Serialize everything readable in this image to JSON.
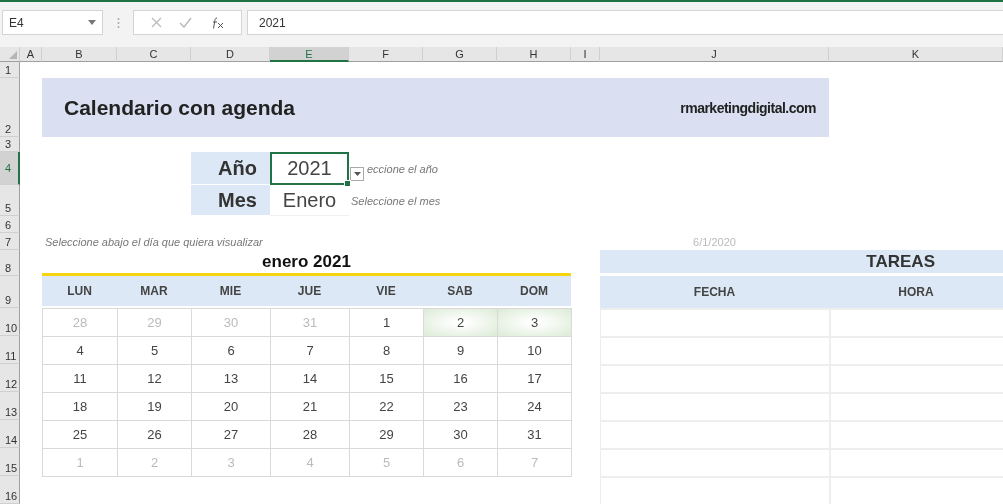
{
  "name_box": {
    "value": "E4"
  },
  "formula_bar": {
    "value": "2021"
  },
  "column_headers": [
    {
      "label": "A",
      "selected": false
    },
    {
      "label": "B",
      "selected": false
    },
    {
      "label": "C",
      "selected": false
    },
    {
      "label": "D",
      "selected": false
    },
    {
      "label": "E",
      "selected": true
    },
    {
      "label": "F",
      "selected": false
    },
    {
      "label": "G",
      "selected": false
    },
    {
      "label": "H",
      "selected": false
    },
    {
      "label": "I",
      "selected": false
    },
    {
      "label": "J",
      "selected": false
    },
    {
      "label": "K",
      "selected": false
    }
  ],
  "row_headers": [
    {
      "label": "1",
      "selected": false
    },
    {
      "label": "2",
      "selected": false
    },
    {
      "label": "3",
      "selected": false
    },
    {
      "label": "4",
      "selected": true
    },
    {
      "label": "5",
      "selected": false
    },
    {
      "label": "6",
      "selected": false
    },
    {
      "label": "7",
      "selected": false
    },
    {
      "label": "8",
      "selected": false
    },
    {
      "label": "9",
      "selected": false
    },
    {
      "label": "10",
      "selected": false
    },
    {
      "label": "11",
      "selected": false
    },
    {
      "label": "12",
      "selected": false
    },
    {
      "label": "13",
      "selected": false
    },
    {
      "label": "14",
      "selected": false
    },
    {
      "label": "15",
      "selected": false
    },
    {
      "label": "16",
      "selected": false
    }
  ],
  "banner": {
    "title": "Calendario con agenda",
    "site": "rmarketingdigital.com"
  },
  "year": {
    "label": "Año",
    "value": "2021",
    "hint": "eccione el año",
    "selected": true
  },
  "month": {
    "label": "Mes",
    "value": "Enero",
    "hint": "Seleccione el mes",
    "selected": false
  },
  "day_hint": "Seleccione abajo el día que quiera visualizar",
  "selected_date": "6/1/2020",
  "calendar": {
    "title": "enero 2021",
    "weekdays": [
      "LUN",
      "MAR",
      "MIE",
      "JUE",
      "VIE",
      "SAB",
      "DOM"
    ],
    "weeks": [
      [
        {
          "day": "28",
          "other_month": true,
          "highlighted": false
        },
        {
          "day": "29",
          "other_month": true,
          "highlighted": false
        },
        {
          "day": "30",
          "other_month": true,
          "highlighted": false
        },
        {
          "day": "31",
          "other_month": true,
          "highlighted": false
        },
        {
          "day": "1",
          "other_month": false,
          "highlighted": false
        },
        {
          "day": "2",
          "other_month": false,
          "highlighted": true
        },
        {
          "day": "3",
          "other_month": false,
          "highlighted": true
        }
      ],
      [
        {
          "day": "4",
          "other_month": false,
          "highlighted": false
        },
        {
          "day": "5",
          "other_month": false,
          "highlighted": false
        },
        {
          "day": "6",
          "other_month": false,
          "highlighted": false
        },
        {
          "day": "7",
          "other_month": false,
          "highlighted": false
        },
        {
          "day": "8",
          "other_month": false,
          "highlighted": false
        },
        {
          "day": "9",
          "other_month": false,
          "highlighted": false
        },
        {
          "day": "10",
          "other_month": false,
          "highlighted": false
        }
      ],
      [
        {
          "day": "11",
          "other_month": false,
          "highlighted": false
        },
        {
          "day": "12",
          "other_month": false,
          "highlighted": false
        },
        {
          "day": "13",
          "other_month": false,
          "highlighted": false
        },
        {
          "day": "14",
          "other_month": false,
          "highlighted": false
        },
        {
          "day": "15",
          "other_month": false,
          "highlighted": false
        },
        {
          "day": "16",
          "other_month": false,
          "highlighted": false
        },
        {
          "day": "17",
          "other_month": false,
          "highlighted": false
        }
      ],
      [
        {
          "day": "18",
          "other_month": false,
          "highlighted": false
        },
        {
          "day": "19",
          "other_month": false,
          "highlighted": false
        },
        {
          "day": "20",
          "other_month": false,
          "highlighted": false
        },
        {
          "day": "21",
          "other_month": false,
          "highlighted": false
        },
        {
          "day": "22",
          "other_month": false,
          "highlighted": false
        },
        {
          "day": "23",
          "other_month": false,
          "highlighted": false
        },
        {
          "day": "24",
          "other_month": false,
          "highlighted": false
        }
      ],
      [
        {
          "day": "25",
          "other_month": false,
          "highlighted": false
        },
        {
          "day": "26",
          "other_month": false,
          "highlighted": false
        },
        {
          "day": "27",
          "other_month": false,
          "highlighted": false
        },
        {
          "day": "28",
          "other_month": false,
          "highlighted": false
        },
        {
          "day": "29",
          "other_month": false,
          "highlighted": false
        },
        {
          "day": "30",
          "other_month": false,
          "highlighted": false
        },
        {
          "day": "31",
          "other_month": false,
          "highlighted": false
        }
      ],
      [
        {
          "day": "1",
          "other_month": true,
          "highlighted": false
        },
        {
          "day": "2",
          "other_month": true,
          "highlighted": false
        },
        {
          "day": "3",
          "other_month": true,
          "highlighted": false
        },
        {
          "day": "4",
          "other_month": true,
          "highlighted": false
        },
        {
          "day": "5",
          "other_month": true,
          "highlighted": false
        },
        {
          "day": "6",
          "other_month": true,
          "highlighted": false
        },
        {
          "day": "7",
          "other_month": true,
          "highlighted": false
        }
      ]
    ]
  },
  "tasks": {
    "title": "TAREAS",
    "columns": [
      "FECHA",
      "HORA"
    ]
  }
}
